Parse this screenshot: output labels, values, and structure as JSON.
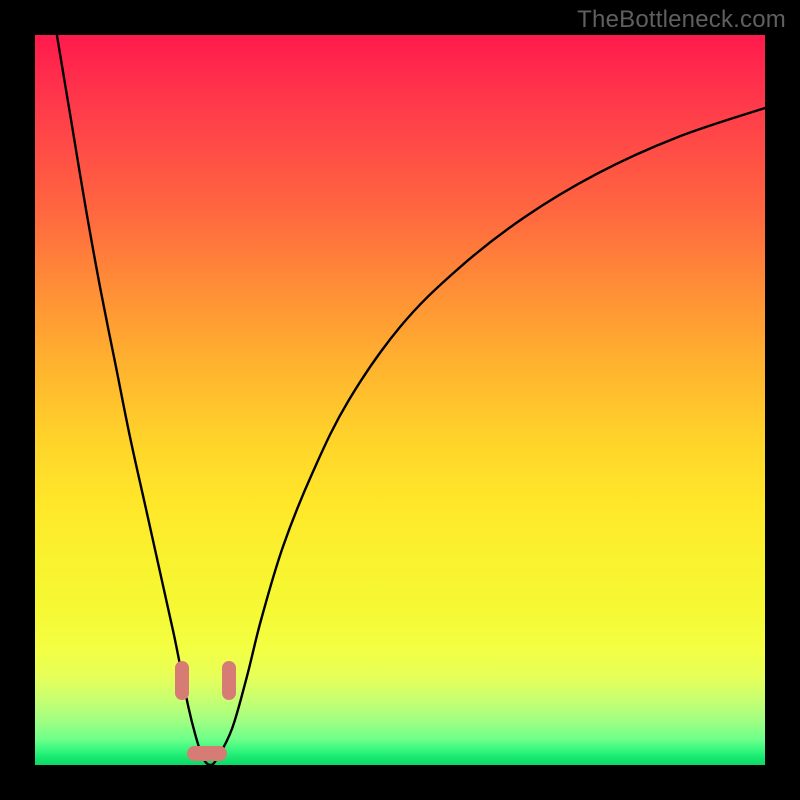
{
  "watermark": "TheBottleneck.com",
  "colors": {
    "frame": "#000000",
    "curve_stroke": "#000000",
    "marker_fill": "#d77c74",
    "gradient_top": "#ff1a4d",
    "gradient_bottom": "#0cd865"
  },
  "chart_data": {
    "type": "line",
    "title": "",
    "xlabel": "",
    "ylabel": "",
    "xlim": [
      0,
      100
    ],
    "ylim": [
      0,
      100
    ],
    "x": [
      3,
      5,
      7,
      9,
      11,
      13,
      15,
      17,
      19,
      20,
      21,
      22,
      23,
      24,
      25,
      27,
      29,
      31,
      34,
      38,
      43,
      50,
      58,
      67,
      77,
      88,
      100
    ],
    "values": [
      100,
      88,
      76,
      65,
      55,
      45,
      36,
      27,
      18,
      13,
      8,
      4,
      1,
      0,
      1,
      5,
      12,
      20,
      30,
      40,
      50,
      60,
      68,
      75,
      81,
      86,
      90
    ],
    "annotations": [
      {
        "shape": "marker-v",
        "x": 20.5,
        "y_top": 13.5,
        "y_bot": 8.0
      },
      {
        "shape": "marker-v",
        "x": 26.0,
        "y_top": 13.5,
        "y_bot": 8.0
      },
      {
        "shape": "marker-h",
        "x_left": 21.5,
        "x_right": 25.5,
        "y": 1.5
      }
    ]
  }
}
